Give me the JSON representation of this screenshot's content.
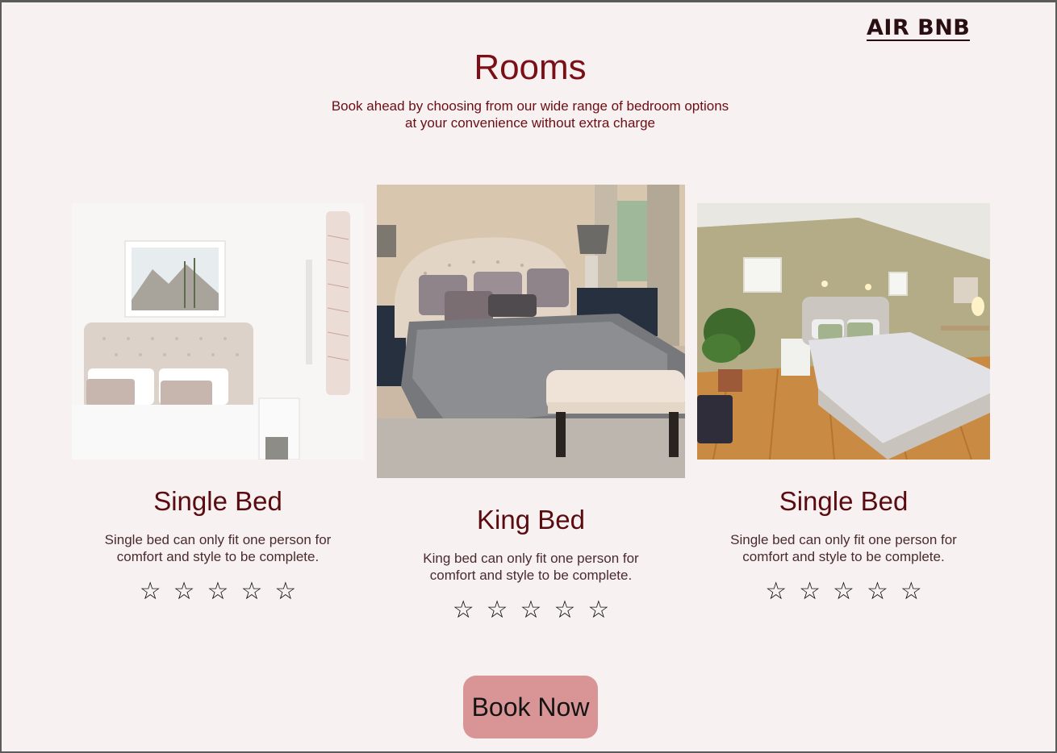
{
  "brand": {
    "logo_text": "AIR BNB"
  },
  "header": {
    "title": "Rooms",
    "subtitle": "Book ahead by choosing from our wide range of bedroom options at your convenience without extra charge"
  },
  "rooms": [
    {
      "title": "Single Bed",
      "description": "Single bed can only fit one person for comfort and style to be complete.",
      "image": "white-bedroom-photo",
      "rating": 0,
      "stars": [
        "☆",
        "☆",
        "☆",
        "☆",
        "☆"
      ]
    },
    {
      "title": "King Bed",
      "description": "King bed can only fit one person for comfort and style to be complete.",
      "image": "king-bedroom-photo",
      "rating": 0,
      "stars": [
        "☆",
        "☆",
        "☆",
        "☆",
        "☆"
      ]
    },
    {
      "title": "Single Bed",
      "description": "Single bed can only fit one person for comfort and style to be complete.",
      "image": "wood-floor-bedroom-photo",
      "rating": 0,
      "stars": [
        "☆",
        "☆",
        "☆",
        "☆",
        "☆"
      ]
    }
  ],
  "cta": {
    "label": "Book Now"
  },
  "colors": {
    "background": "#f8f1f1",
    "title": "#7a0f15",
    "button": "#d99596"
  }
}
